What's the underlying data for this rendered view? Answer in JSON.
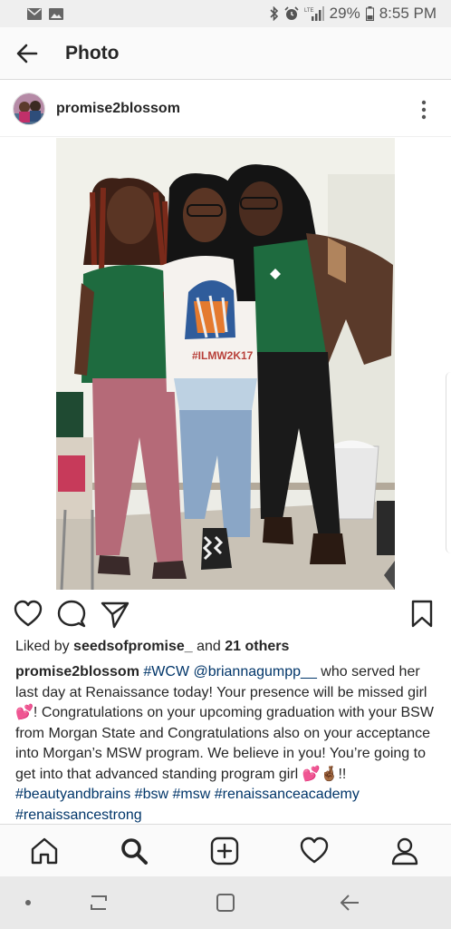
{
  "status_bar": {
    "battery": "29%",
    "time": "8:55 PM"
  },
  "header": {
    "title": "Photo"
  },
  "post": {
    "username": "promise2blossom",
    "shirt_text": "#ILMW2K17"
  },
  "likes": {
    "prefix": "Liked by ",
    "liker": "seedsofpromise_",
    "middle": " and ",
    "others": "21 others"
  },
  "caption": {
    "username": "promise2blossom",
    "tag_wcw": "#WCW",
    "mention": "@briannagumpp__",
    "text1": " who served her last day at Renaissance today! Your presence will be missed girl",
    "emoji_heart": "💕",
    "text2": "! Congratulations on your upcoming graduation with your BSW from Morgan State and Congratulations also on your acceptance into Morgan’s MSW program. We believe in you! You’re going to get into that advanced standing program girl ",
    "emoji_pair": "💕🤞🏾",
    "text3": "!! ",
    "tag_beauty": "#beautyandbrains",
    "tag_bsw": "#bsw",
    "tag_msw": "#msw",
    "tag_academy": "#renaissanceacademy",
    "tag_strong": "#renaissancestrong"
  },
  "colors": {
    "hashtag": "#003569",
    "text": "#262626",
    "bar_bg": "#fafafa"
  },
  "icons": {
    "back": "arrow-left-icon",
    "more": "more-vertical-icon",
    "like": "heart-icon",
    "comment": "comment-icon",
    "share": "send-icon",
    "save": "bookmark-icon",
    "home": "home-icon",
    "search": "search-icon",
    "add": "add-post-icon",
    "activity": "heart-icon",
    "profile": "profile-icon"
  }
}
